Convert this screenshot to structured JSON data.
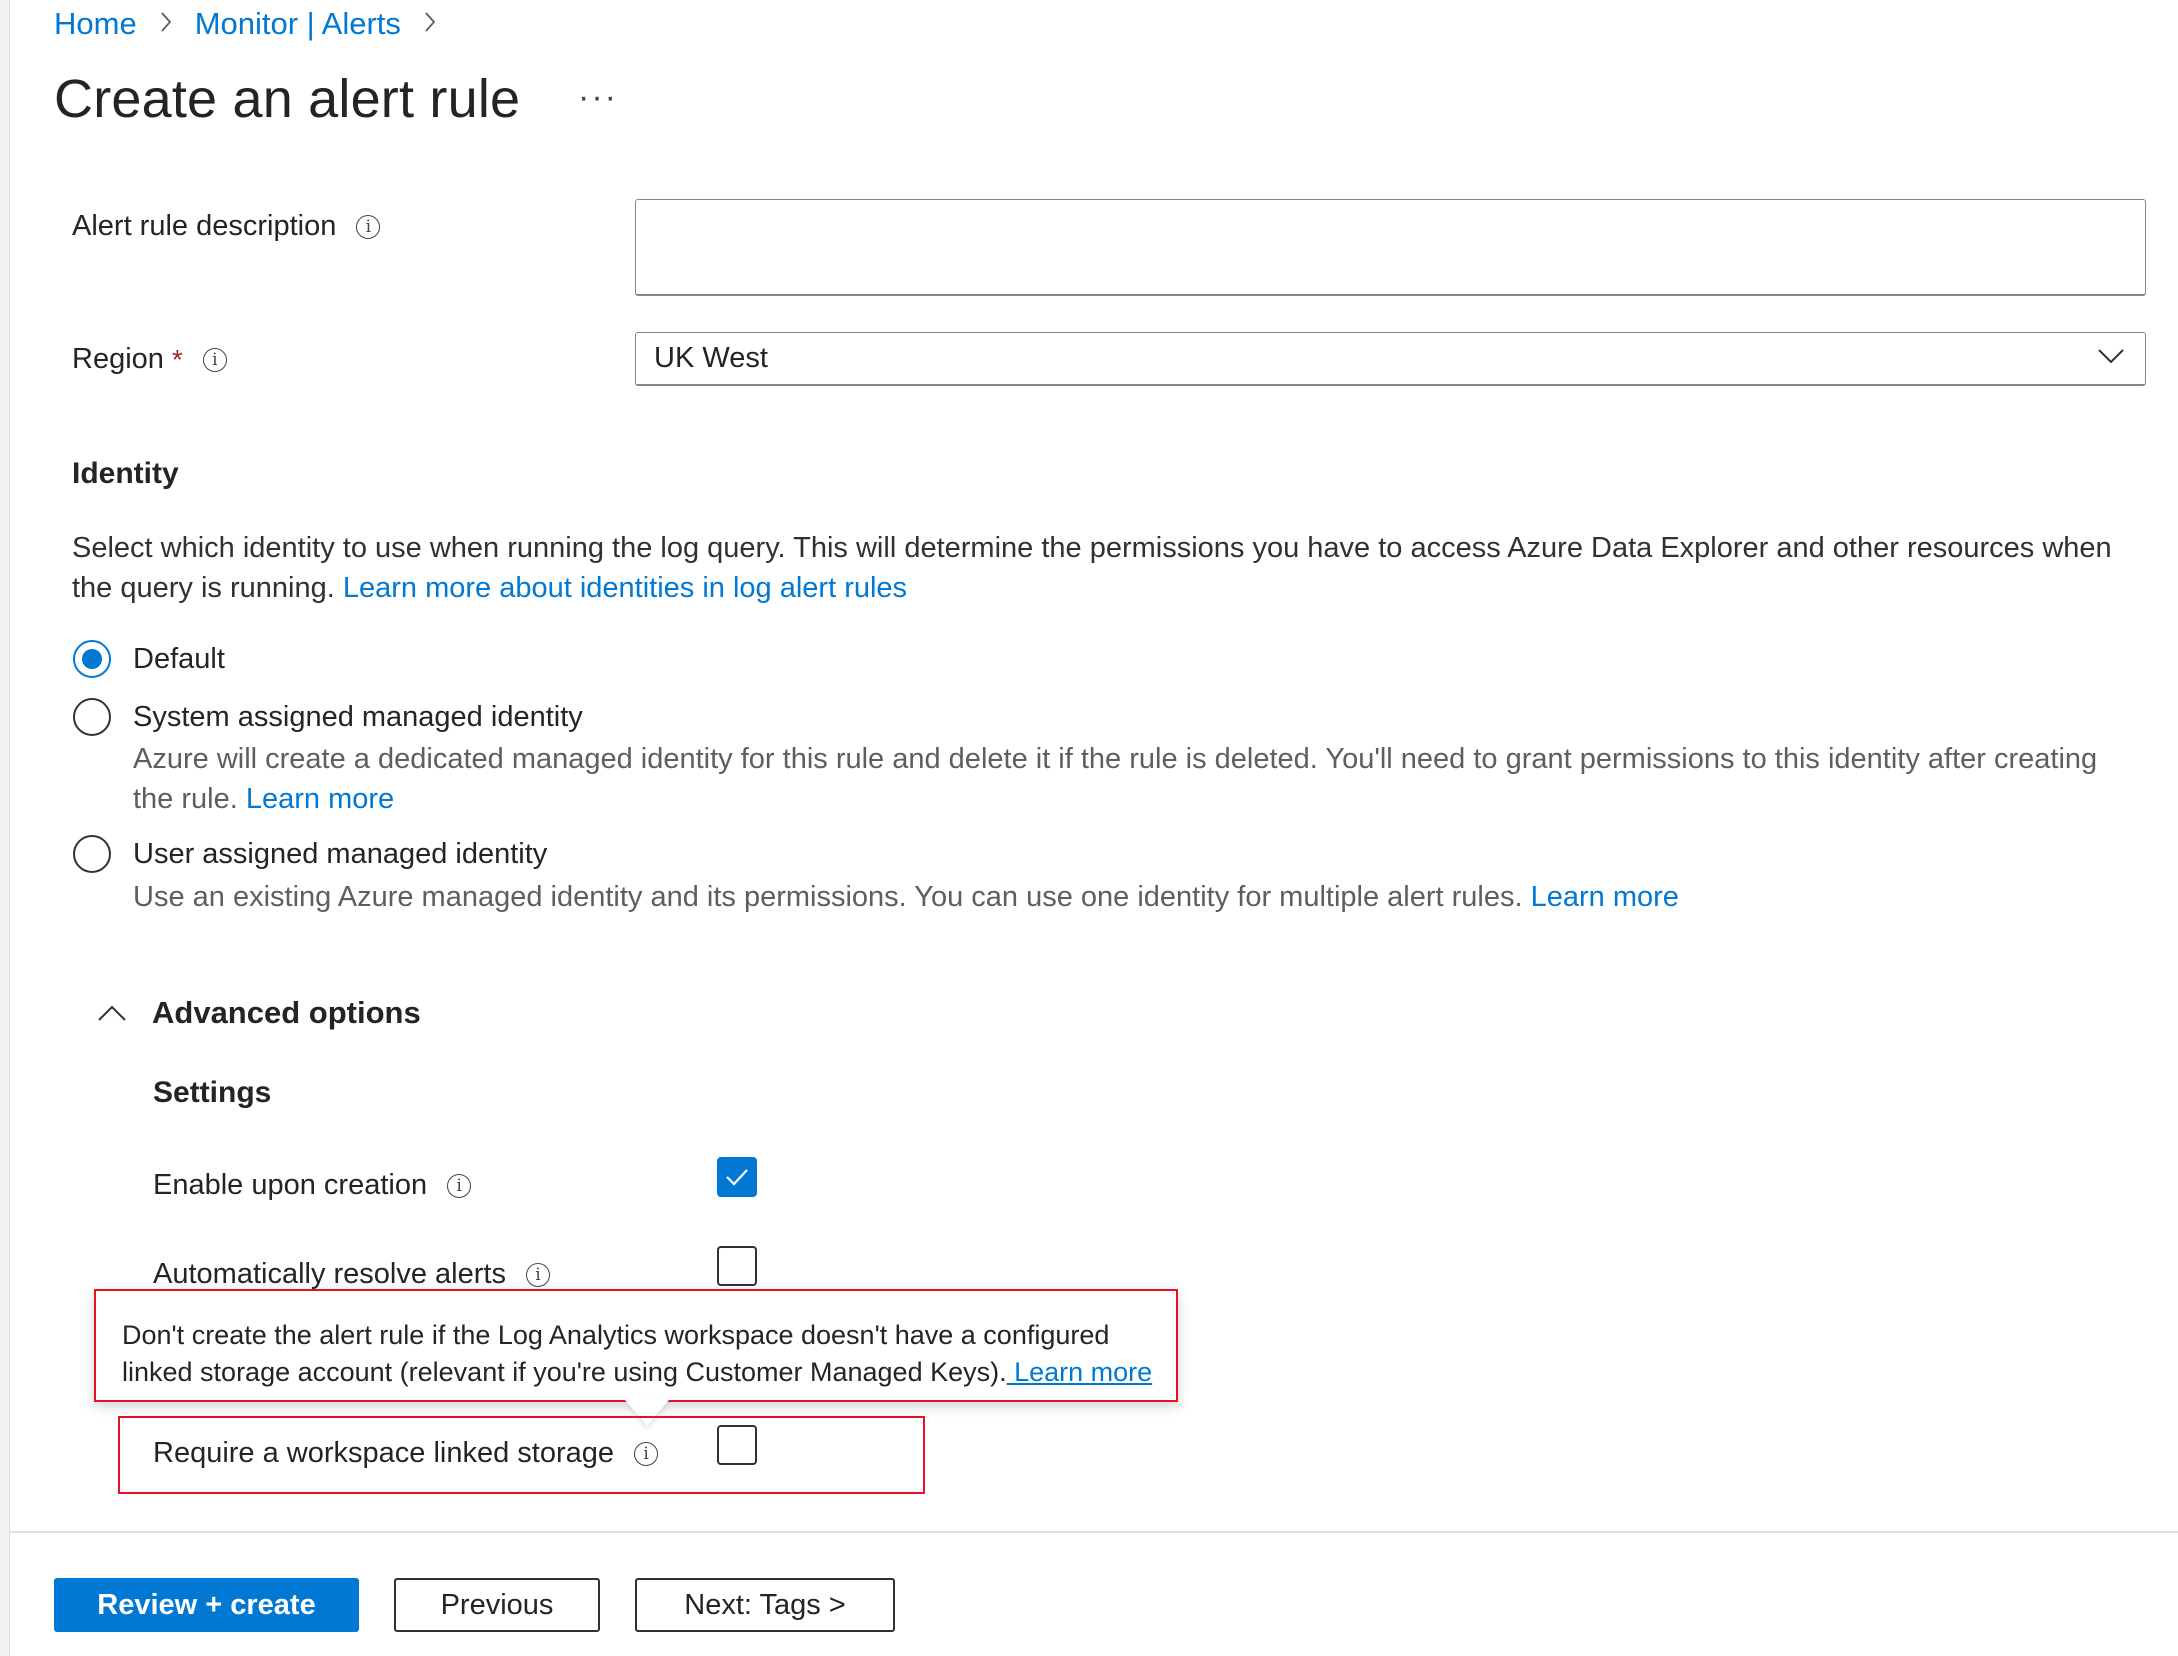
{
  "breadcrumb": {
    "items": [
      {
        "label": "Home"
      },
      {
        "label": "Monitor | Alerts"
      }
    ],
    "separator": ">"
  },
  "page": {
    "title": "Create an alert rule",
    "more_actions": "···"
  },
  "form": {
    "description": {
      "label": "Alert rule description",
      "value": "",
      "info_icon": "info-icon"
    },
    "region": {
      "label": "Region",
      "required_marker": "*",
      "value": "UK West",
      "info_icon": "info-icon"
    }
  },
  "identity": {
    "heading": "Identity",
    "description": "Select which identity to use when running the log query. This will determine the permissions you have to access Azure Data Explorer and other resources when the query is running.",
    "description_link": "Learn more about identities in log alert rules",
    "options": [
      {
        "label": "Default",
        "selected": true,
        "description": "",
        "link": ""
      },
      {
        "label": "System assigned managed identity",
        "selected": false,
        "description": "Azure will create a dedicated managed identity for this rule and delete it if the rule is deleted. You'll need to grant permissions to this identity after creating the rule.",
        "link": "Learn more"
      },
      {
        "label": "User assigned managed identity",
        "selected": false,
        "description": "Use an existing Azure managed identity and its permissions. You can use one identity for multiple alert rules.",
        "link": "Learn more"
      }
    ]
  },
  "advanced": {
    "toggle_label": "Advanced options",
    "expanded": true,
    "settings_heading": "Settings",
    "settings": [
      {
        "label": "Enable upon creation",
        "checked": true
      },
      {
        "label": "Automatically resolve alerts",
        "checked": false
      },
      {
        "label": "Require a workspace linked storage",
        "checked": false
      }
    ],
    "tooltip": {
      "text": "Don't create the alert rule if the Log Analytics workspace doesn't have a configured linked storage account (relevant if you're using Customer Managed Keys).",
      "link": " Learn more"
    }
  },
  "footer": {
    "review_create": "Review + create",
    "previous": "Previous",
    "next": "Next: Tags >"
  },
  "colors": {
    "accent": "#0078d4",
    "highlight_border": "#e81123",
    "required": "#a4262c"
  }
}
